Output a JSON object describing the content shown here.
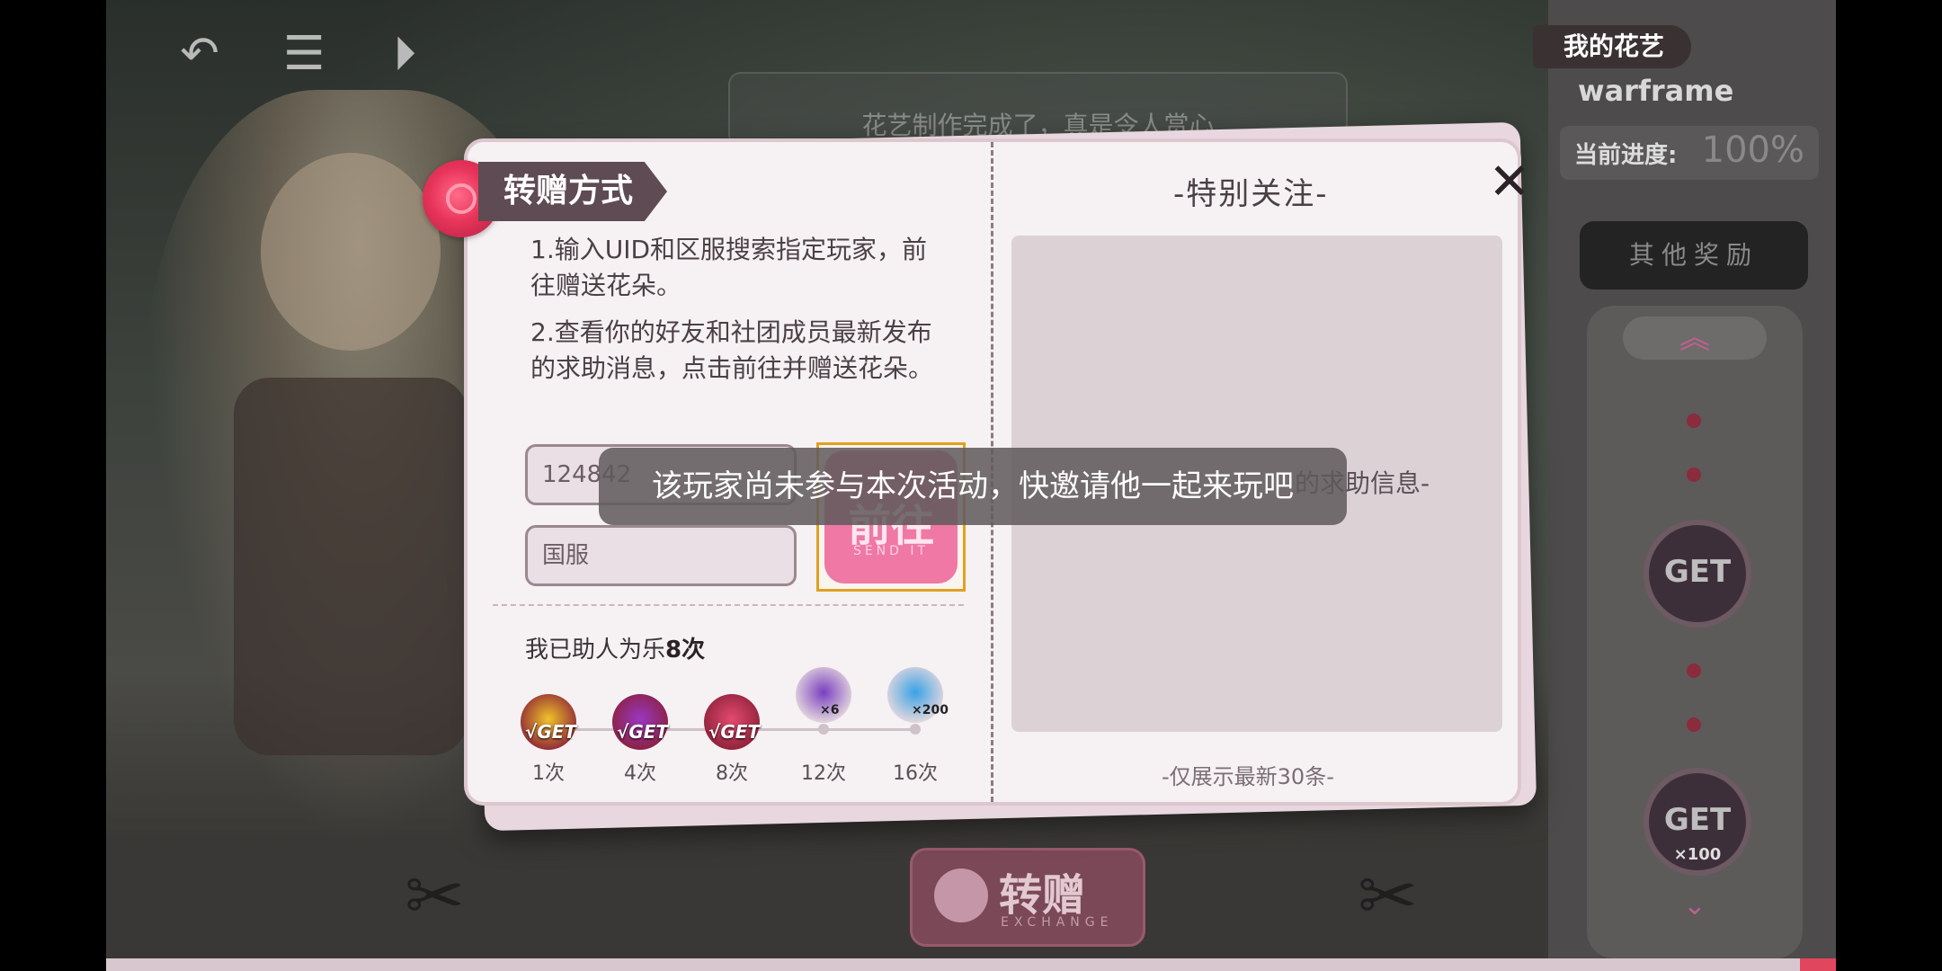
{
  "background_banner": {
    "text": "花艺制作完成了，真是令人赏心"
  },
  "top_icons": [
    "back-icon",
    "menu-icon",
    "skip-icon"
  ],
  "right_panel": {
    "tag": "我的花艺",
    "player_name": "warframe",
    "progress_label": "当前进度:",
    "progress_value": "100%",
    "other_rewards_button": "其他奖励",
    "reward_get_label": "GET",
    "reward_count": "×100"
  },
  "bottom_bar": {
    "exchange_label": "转赠",
    "exchange_sub": "EXCHANGE"
  },
  "dialog": {
    "title": "转赠方式",
    "instructions": [
      "1.输入UID和区服搜索指定玩家，前往赠送花朵。",
      "2.查看你的好友和社团成员最新发布的求助消息，点击前往并赠送花朵。"
    ],
    "uid_input_value": "124842",
    "server_input_value": "国服",
    "go_button_label": "前往",
    "go_button_sub": "SEND IT",
    "helped_prefix": "我已助人为乐",
    "helped_count": "8次",
    "milestones": [
      {
        "label": "1次",
        "get": "√GET",
        "count": "",
        "color": "#f2c229",
        "claimed": true
      },
      {
        "label": "4次",
        "get": "√GET",
        "count": "",
        "color": "#9b36c4",
        "claimed": true
      },
      {
        "label": "8次",
        "get": "√GET",
        "count": "",
        "color": "#e34a6e",
        "claimed": true
      },
      {
        "label": "12次",
        "get": "",
        "count": "×6",
        "color": "#7a3fc0",
        "claimed": false
      },
      {
        "label": "16次",
        "get": "",
        "count": "×200",
        "color": "#3aa2e6",
        "claimed": false
      }
    ],
    "focus_title": "-特别关注-",
    "focus_empty": "的求助信息-",
    "focus_note": "-仅展示最新30条-"
  },
  "toast": "该玩家尚未参与本次活动，快邀请他一起来玩吧",
  "colors": {
    "accent_pink": "#ef78a4",
    "title_tag": "#5f4b53",
    "go_border": "#e0a020"
  }
}
